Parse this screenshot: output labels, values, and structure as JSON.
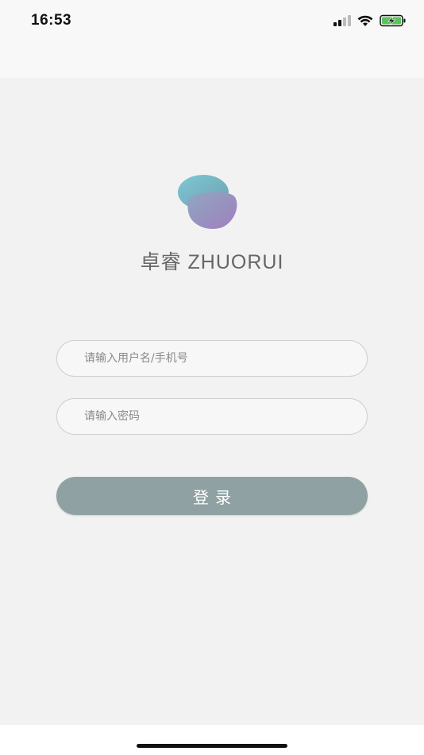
{
  "status_bar": {
    "time": "16:53",
    "icons": [
      "signal-icon",
      "wifi-icon",
      "battery-charging-icon"
    ]
  },
  "brand": {
    "name": "卓睿 ZHUORUI",
    "logo": "zhuorui-logo-icon"
  },
  "form": {
    "username_placeholder": "请输入用户名/手机号",
    "password_placeholder": "请输入密码",
    "login_label": "登录"
  },
  "colors": {
    "background": "#f2f2f2",
    "button": "#8fa1a3",
    "logo_top": "#7cc0cf",
    "logo_bottom": "#9a7fb8"
  }
}
